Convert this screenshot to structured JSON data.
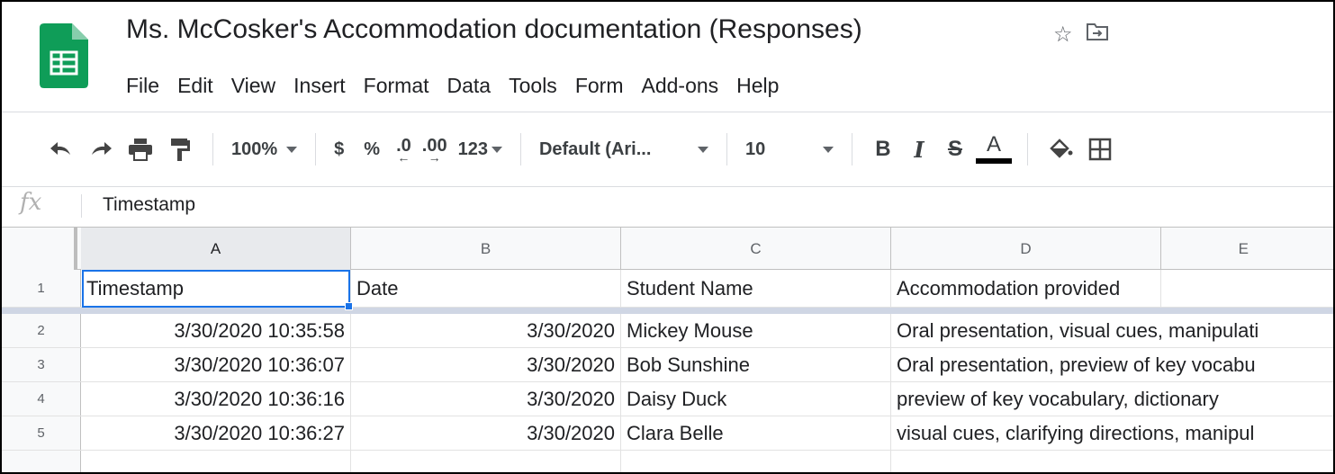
{
  "app": {
    "title": "Ms. McCosker's Accommodation documentation (Responses)",
    "icons": [
      "sheets-logo-icon",
      "star-icon",
      "move-to-folder-icon"
    ],
    "accent_color": "#1a73e8",
    "logo_color": "#0f9d58"
  },
  "menu": {
    "items": [
      "File",
      "Edit",
      "View",
      "Insert",
      "Format",
      "Data",
      "Tools",
      "Form",
      "Add-ons",
      "Help"
    ]
  },
  "toolbar": {
    "zoom": "100%",
    "currency": "$",
    "percent": "%",
    "decrease_decimal": ".0",
    "increase_decimal": ".00",
    "more_formats": "123",
    "font": "Default (Ari...",
    "font_size": "10",
    "bold": "B",
    "italic": "I",
    "strike": "S",
    "text_color": "A",
    "icons": [
      "undo-icon",
      "redo-icon",
      "print-icon",
      "paint-format-icon",
      "fill-color-icon",
      "borders-icon"
    ]
  },
  "formula_bar": {
    "fx": "fx",
    "value": "Timestamp"
  },
  "sheet": {
    "columns": [
      "A",
      "B",
      "C",
      "D",
      "E"
    ],
    "row_numbers": [
      "1",
      "2",
      "3",
      "4",
      "5"
    ],
    "rows": [
      [
        "Timestamp",
        "Date",
        "Student Name",
        "Accommodation provided"
      ],
      [
        "3/30/2020 10:35:58",
        "3/30/2020",
        "Mickey Mouse",
        "Oral presentation, visual cues, manipulati"
      ],
      [
        "3/30/2020 10:36:07",
        "3/30/2020",
        "Bob Sunshine",
        "Oral presentation, preview of key vocabu"
      ],
      [
        "3/30/2020 10:36:16",
        "3/30/2020",
        "Daisy Duck",
        "preview of key vocabulary, dictionary"
      ],
      [
        "3/30/2020 10:36:27",
        "3/30/2020",
        "Clara Belle",
        "visual cues, clarifying directions, manipul"
      ]
    ],
    "selected_cell": "A1"
  }
}
